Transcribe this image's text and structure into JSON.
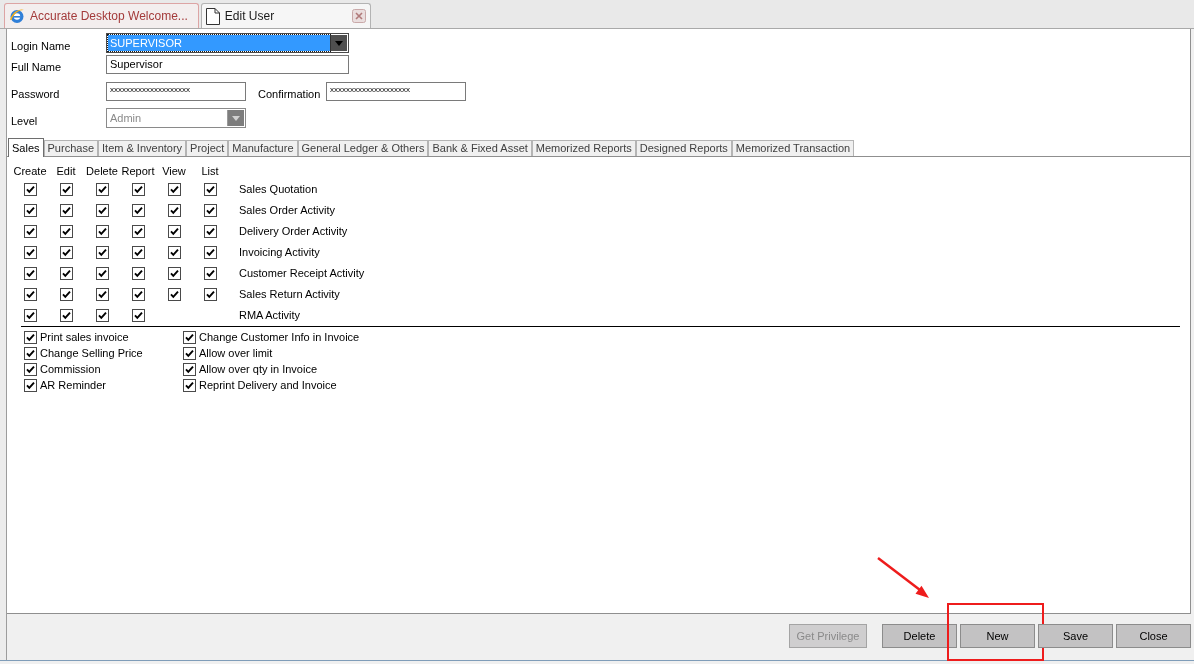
{
  "document_tabs": [
    {
      "label": "Accurate Desktop Welcome...",
      "kind": "web",
      "selected": false
    },
    {
      "label": "Edit User",
      "kind": "document",
      "selected": true
    }
  ],
  "form": {
    "login_name": {
      "label": "Login Name",
      "value": "SUPERVISOR",
      "focused": true
    },
    "full_name": {
      "label": "Full Name",
      "value": "Supervisor"
    },
    "password": {
      "label": "Password",
      "value": "xxxxxxxxxxxxxxxxxxxx"
    },
    "confirmation": {
      "label": "Confirmation",
      "value": "xxxxxxxxxxxxxxxxxxxx"
    },
    "level": {
      "label": "Level",
      "value": "Admin",
      "disabled": true
    }
  },
  "permission_tabs": [
    {
      "label": "Sales",
      "selected": true
    },
    {
      "label": "Purchase",
      "selected": false
    },
    {
      "label": "Item & Inventory",
      "selected": false
    },
    {
      "label": "Project",
      "selected": false
    },
    {
      "label": "Manufacture",
      "selected": false
    },
    {
      "label": "General Ledger & Others",
      "selected": false
    },
    {
      "label": "Bank & Fixed Asset",
      "selected": false
    },
    {
      "label": "Memorized Reports",
      "selected": false
    },
    {
      "label": "Designed Reports",
      "selected": false
    },
    {
      "label": "Memorized Transaction",
      "selected": false
    }
  ],
  "permission_columns": [
    "Create",
    "Edit",
    "Delete",
    "Report",
    "View",
    "List"
  ],
  "permission_rows": [
    {
      "label": "Sales Quotation",
      "checks": [
        true,
        true,
        true,
        true,
        true,
        true
      ]
    },
    {
      "label": "Sales Order Activity",
      "checks": [
        true,
        true,
        true,
        true,
        true,
        true
      ]
    },
    {
      "label": "Delivery Order Activity",
      "checks": [
        true,
        true,
        true,
        true,
        true,
        true
      ]
    },
    {
      "label": "Invoicing Activity",
      "checks": [
        true,
        true,
        true,
        true,
        true,
        true
      ]
    },
    {
      "label": "Customer Receipt Activity",
      "checks": [
        true,
        true,
        true,
        true,
        true,
        true
      ]
    },
    {
      "label": "Sales Return Activity",
      "checks": [
        true,
        true,
        true,
        true,
        true,
        true
      ]
    },
    {
      "label": "RMA Activity",
      "checks": [
        true,
        true,
        true,
        true
      ]
    }
  ],
  "option_columns": [
    [
      {
        "label": "Print sales invoice",
        "checked": true
      },
      {
        "label": "Change Selling Price",
        "checked": true
      },
      {
        "label": "Commission",
        "checked": true
      },
      {
        "label": "AR Reminder",
        "checked": true
      }
    ],
    [
      {
        "label": "Change Customer Info in Invoice",
        "checked": true
      },
      {
        "label": "Allow over limit",
        "checked": true
      },
      {
        "label": "Allow over qty in Invoice",
        "checked": true
      },
      {
        "label": "Reprint Delivery and Invoice",
        "checked": true
      }
    ]
  ],
  "buttons": [
    {
      "label": "Get Privilege",
      "disabled": true,
      "highlighted": false
    },
    {
      "label": "Delete",
      "disabled": false,
      "highlighted": false
    },
    {
      "label": "New",
      "disabled": false,
      "highlighted": true
    },
    {
      "label": "Save",
      "disabled": false,
      "highlighted": false
    },
    {
      "label": "Close",
      "disabled": false,
      "highlighted": false
    }
  ]
}
